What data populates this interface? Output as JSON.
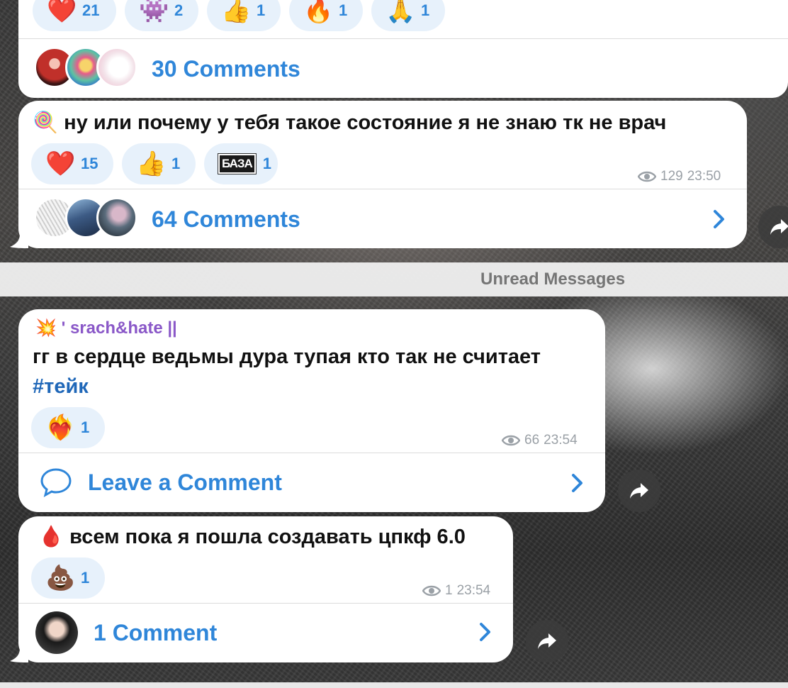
{
  "post1": {
    "reactions": [
      {
        "emoji": "❤️",
        "count": "21"
      },
      {
        "emoji": "👾",
        "count": "2"
      },
      {
        "emoji": "👍",
        "count": "1"
      },
      {
        "emoji": "🔥",
        "count": "1"
      },
      {
        "emoji": "🙏",
        "count": "1"
      }
    ],
    "comments_label": "30 Comments"
  },
  "post2": {
    "emoji": "🍭",
    "text": "ну или почему у тебя такое состояние я не знаю тк не врач",
    "reactions": [
      {
        "emoji": "❤️",
        "count": "15"
      },
      {
        "emoji": "👍",
        "count": "1"
      },
      {
        "emoji": "БАЗА",
        "count": "1"
      }
    ],
    "views": "129",
    "time": "23:50",
    "comments_label": "64 Comments"
  },
  "unread_label": "Unread Messages",
  "post3": {
    "author_emoji": "💥",
    "author": "' srach&hate ||",
    "text": "гг в сердце ведьмы дура тупая кто так не считает",
    "hashtag": "#тейк",
    "reactions": [
      {
        "emoji": "❤️‍🔥",
        "count": "1"
      }
    ],
    "views": "66",
    "time": "23:54",
    "comments_label": "Leave a Comment"
  },
  "post4": {
    "emoji": "🩸",
    "text": "всем пока я пошла создавать цпкф 6.0",
    "reactions": [
      {
        "emoji": "💩",
        "count": "1"
      }
    ],
    "views": "1",
    "time": "23:54",
    "comments_label": "1 Comment"
  },
  "icons": {
    "eye": "eye-icon",
    "chevron": "chevron-right-icon",
    "share": "share-icon",
    "comment": "speech-bubble-icon"
  },
  "colors": {
    "accent": "#2f86d9",
    "reaction_bg": "#e7f1fb",
    "author": "#8a58c8",
    "meta": "#9aa0a6"
  }
}
